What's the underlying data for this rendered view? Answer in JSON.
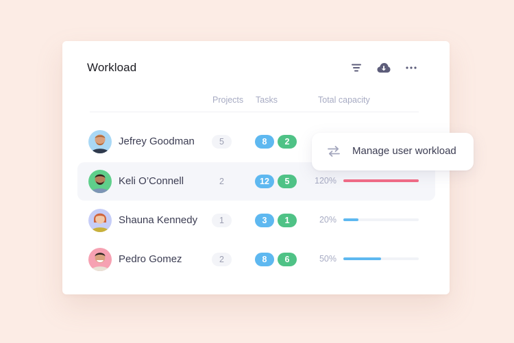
{
  "widget": {
    "title": "Workload",
    "toolbar": {
      "filter_icon": "filter-icon",
      "download_icon": "cloud-download-icon",
      "more_icon": "more-horizontal-icon"
    },
    "columns": {
      "projects": "Projects",
      "tasks": "Tasks",
      "capacity": "Total capacity"
    },
    "rows": [
      {
        "name": "Jefrey Goodman",
        "projects": "5",
        "tasks_open": "8",
        "tasks_done": "2",
        "capacity_label": "",
        "capacity_pct": null,
        "avatar_bg": "#a9d8f5",
        "highlight": false
      },
      {
        "name": "Keli O’Connell",
        "projects": "2",
        "tasks_open": "12",
        "tasks_done": "5",
        "capacity_label": "120%",
        "capacity_pct": 120,
        "avatar_bg": "#5fcf8b",
        "highlight": true
      },
      {
        "name": "Shauna Kennedy",
        "projects": "1",
        "tasks_open": "3",
        "tasks_done": "1",
        "capacity_label": "20%",
        "capacity_pct": 20,
        "avatar_bg": "#c6cdf7",
        "highlight": false
      },
      {
        "name": "Pedro Gomez",
        "projects": "2",
        "tasks_open": "8",
        "tasks_done": "6",
        "capacity_label": "50%",
        "capacity_pct": 50,
        "avatar_bg": "#f6a1b2",
        "highlight": false
      }
    ]
  },
  "popup": {
    "icon": "swap-arrows-icon",
    "label": "Manage user workload"
  },
  "colors": {
    "background": "#fcece5",
    "task_open": "#5eb8f0",
    "task_done": "#4fc286",
    "capacity_normal": "#5eb8f0",
    "capacity_over": "#f26b86",
    "text_primary": "#3b3c52",
    "text_muted": "#a7abc3"
  }
}
